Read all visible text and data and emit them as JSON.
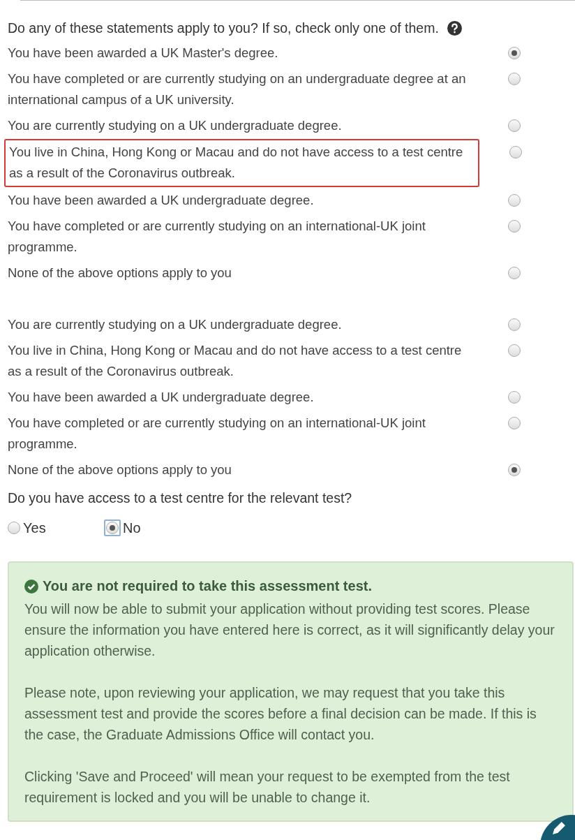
{
  "question": "Do any of these statements apply to you? If so, check only one of them.",
  "option_groups": [
    {
      "options": [
        {
          "label": "You have been awarded a UK Master's degree.",
          "selected": true,
          "highlighted": false
        },
        {
          "label": "You have completed or are currently studying on an undergraduate degree at an international campus of a UK university.",
          "selected": false,
          "highlighted": false
        },
        {
          "label": "You are currently studying on a UK undergraduate degree.",
          "selected": false,
          "highlighted": false
        },
        {
          "label": "You live in China, Hong Kong or Macau and do not have access to a test centre as a result of the Coronavirus outbreak.",
          "selected": false,
          "highlighted": true
        },
        {
          "label": "You have been awarded a UK undergraduate degree.",
          "selected": false,
          "highlighted": false
        },
        {
          "label": "You have completed or are currently studying on an international-UK joint programme.",
          "selected": false,
          "highlighted": false
        },
        {
          "label": "None of the above options apply to you",
          "selected": false,
          "highlighted": false
        }
      ]
    },
    {
      "options": [
        {
          "label": "You are currently studying on a UK undergraduate degree.",
          "selected": false,
          "highlighted": false
        },
        {
          "label": "You live in China, Hong Kong or Macau and do not have access to a test centre as a result of the Coronavirus outbreak.",
          "selected": false,
          "highlighted": false
        },
        {
          "label": "You have been awarded a UK undergraduate degree.",
          "selected": false,
          "highlighted": false
        },
        {
          "label": "You have completed or are currently studying on an international-UK joint programme.",
          "selected": false,
          "highlighted": false
        },
        {
          "label": "None of the above options apply to you",
          "selected": true,
          "highlighted": false
        }
      ]
    }
  ],
  "access_question": {
    "label": "Do you have access to a test centre for the relevant test?",
    "options": [
      {
        "label": "Yes",
        "selected": false,
        "focused": false
      },
      {
        "label": "No",
        "selected": true,
        "focused": true
      }
    ]
  },
  "alert": {
    "title": "You are not required to take this assessment test.",
    "paragraphs": [
      "You will now be able to submit your application without providing test scores. Please ensure the information you have entered here is correct, as it will significantly delay your application otherwise.",
      "Please note, upon reviewing your application, we may request that you take this assessment test and provide the scores before a final decision can be made. If this is the case, the Graduate Admissions Office will contact you.",
      "Clicking 'Save and Proceed' will mean your request to be exempted from the test requirement is locked and you will be unable to change it."
    ]
  }
}
